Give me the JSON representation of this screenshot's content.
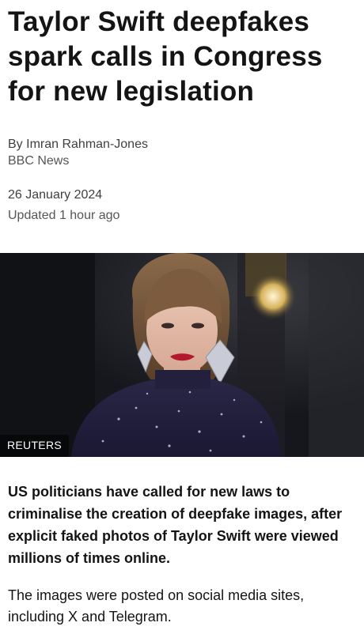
{
  "article": {
    "headline": "Taylor Swift deepfakes spark calls in Congress for new legislation",
    "byline": {
      "author": "By Imran Rahman-Jones",
      "source": "BBC News"
    },
    "dates": {
      "published": "26 January 2024",
      "updated": "Updated 1 hour ago"
    },
    "image": {
      "credit": "REUTERS",
      "subject": "photo-of-taylor-swift"
    },
    "lede": "US politicians have called for new laws to criminalise the creation of deepfake images, after explicit faked photos of Taylor Swift were viewed millions of times online.",
    "paragraphs": [
      "The images were posted on social media sites, including X and Telegram."
    ]
  },
  "colors": {
    "text": "#141414",
    "meta": "#545658",
    "image_background": "#1b1c22"
  }
}
